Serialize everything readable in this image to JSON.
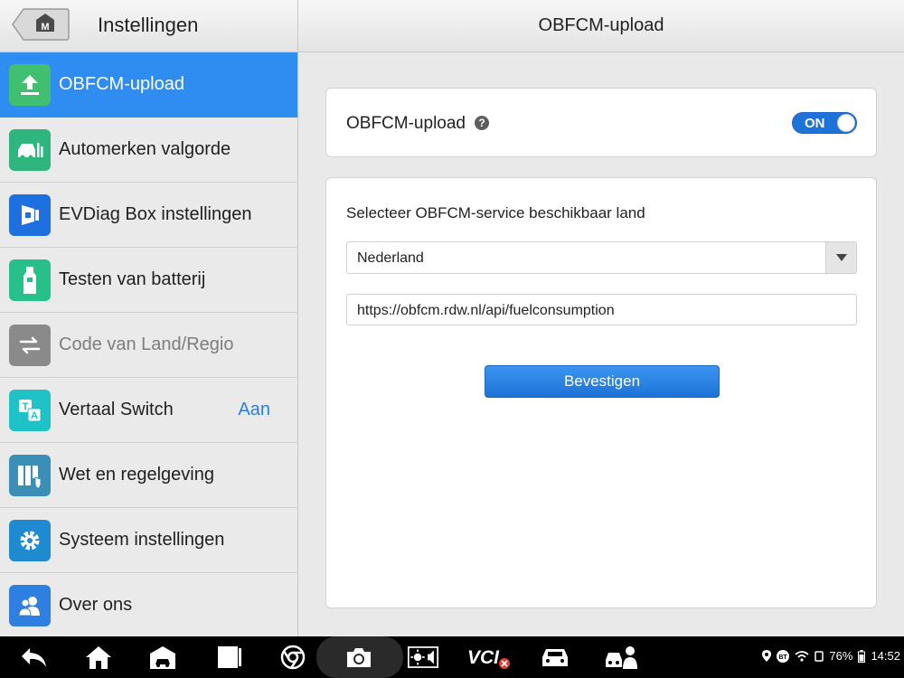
{
  "header": {
    "home_icon": "home-m-icon",
    "home_letter": "M",
    "title": "Instellingen",
    "page_title": "OBFCM-upload"
  },
  "sidebar": {
    "items": [
      {
        "label": "OBFCM-upload",
        "icon": "upload-icon",
        "active": true,
        "icon_color": "#3fbf6f"
      },
      {
        "label": "Automerken valgorde",
        "icon": "car-sort-icon",
        "icon_color": "#2fb680"
      },
      {
        "label": "EVDiag Box instellingen",
        "icon": "evdiag-box-icon",
        "icon_color": "#1e6fe0"
      },
      {
        "label": "Testen van batterij",
        "icon": "battery-tester-icon",
        "icon_color": "#27c08a"
      },
      {
        "label": "Code van Land/Regio",
        "icon": "swap-arrows-icon",
        "disabled": true,
        "icon_color": "#8a8a8a"
      },
      {
        "label": "Vertaal Switch",
        "value": "Aan",
        "icon": "translate-icon",
        "icon_color": "#1fc2c6"
      },
      {
        "label": "Wet en regelgeving",
        "icon": "law-books-icon",
        "icon_color": "#3b8fb6"
      },
      {
        "label": "Systeem instellingen",
        "icon": "gear-icon",
        "icon_color": "#1e8bd0"
      },
      {
        "label": "Over ons",
        "icon": "people-icon",
        "icon_color": "#2f7fe0"
      }
    ]
  },
  "main": {
    "upload": {
      "label": "OBFCM-upload",
      "help_glyph": "?",
      "toggle_text": "ON",
      "toggle_on": true
    },
    "country": {
      "label": "Selecteer OBFCM-service beschikbaar land",
      "selected": "Nederland",
      "url": "https://obfcm.rdw.nl/api/fuelconsumption",
      "confirm_label": "Bevestigen"
    }
  },
  "taskbar": {
    "icons": [
      "back-icon",
      "home-icon",
      "car-garage-icon",
      "recent-apps-icon",
      "chrome-icon",
      "camera-icon",
      "brightness-volume-icon",
      "vci-icon",
      "car-icon",
      "mechanic-icon"
    ],
    "vci_label": "VCI",
    "status": {
      "battery": "76%",
      "time": "14:52",
      "bt_label": "BT"
    }
  },
  "colors": {
    "accent": "#2f8cf0",
    "toggle": "#1e73d8",
    "link_value": "#2b7fe0"
  }
}
